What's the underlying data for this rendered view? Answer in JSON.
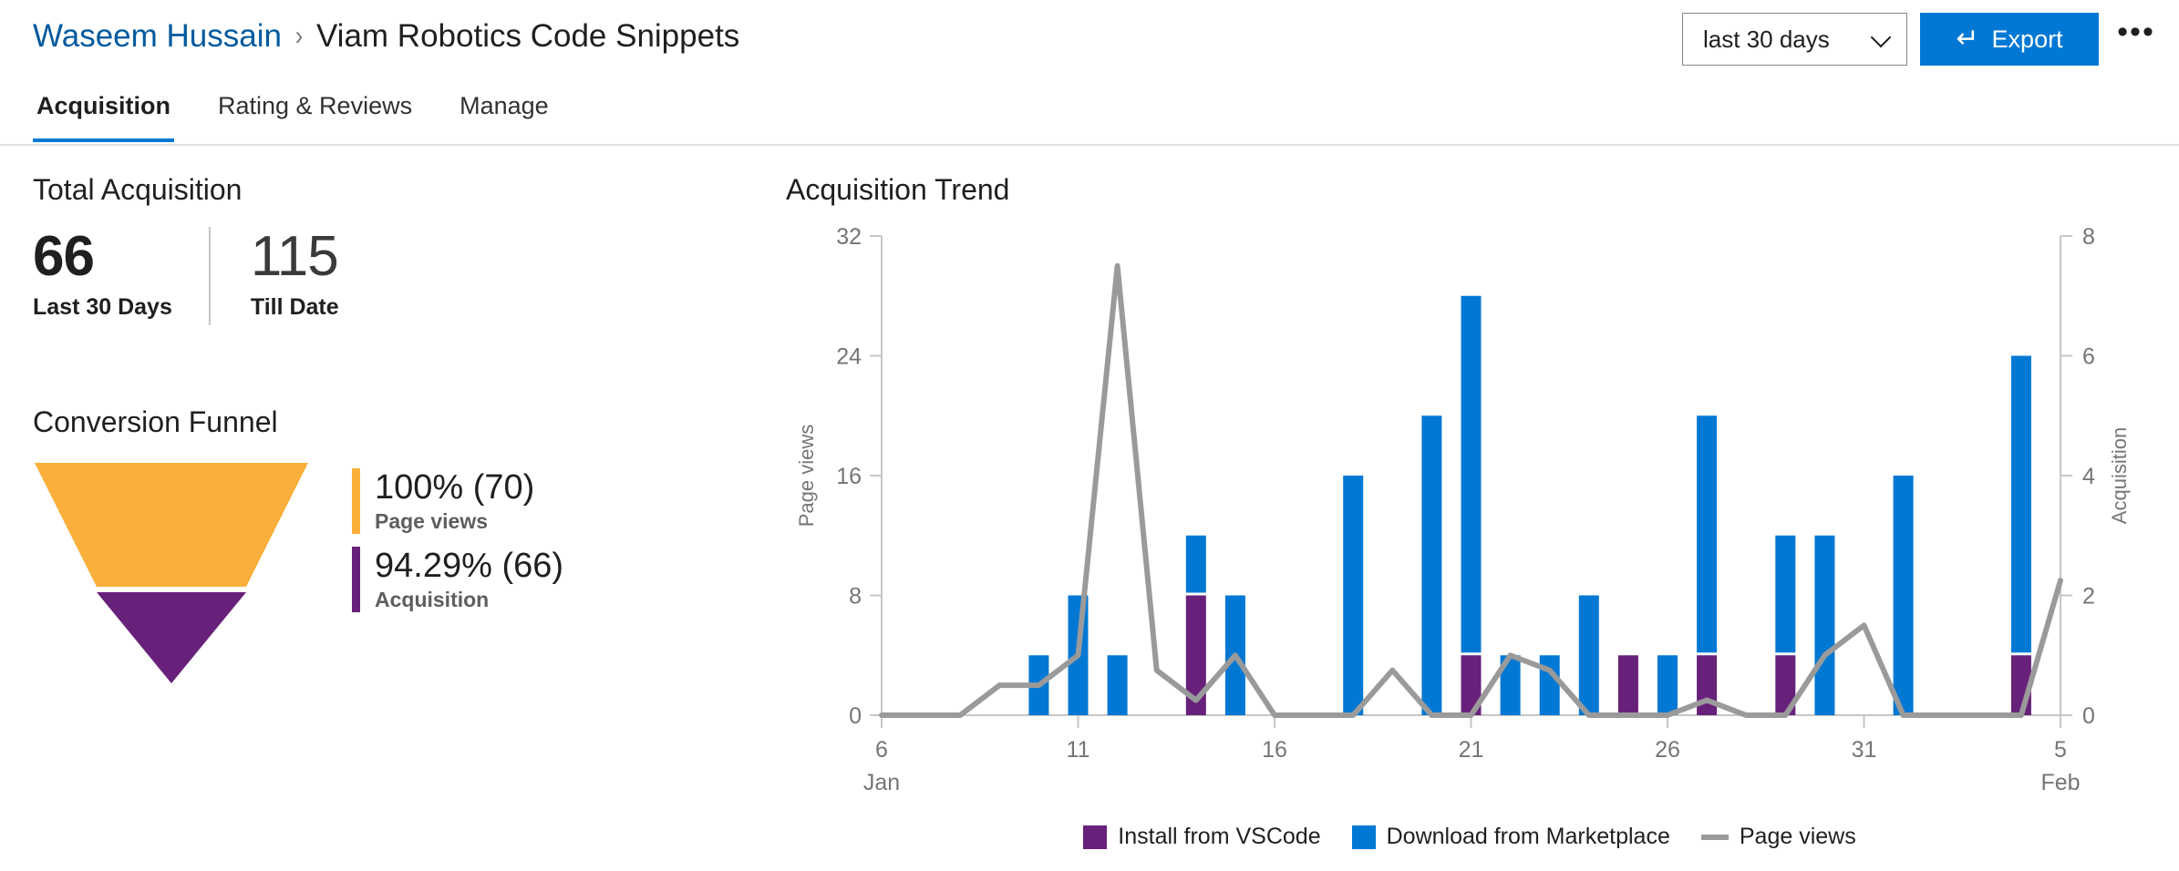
{
  "header": {
    "breadcrumb": {
      "parent": "Waseem Hussain",
      "separator": "›",
      "current": "Viam Robotics Code Snippets"
    },
    "date_range_value": "last 30 days",
    "export_label": "Export",
    "export_icon": "↵",
    "more_label": "•••"
  },
  "tabs": [
    {
      "label": "Acquisition",
      "active": true
    },
    {
      "label": "Rating & Reviews",
      "active": false
    },
    {
      "label": "Manage",
      "active": false
    }
  ],
  "total_acquisition": {
    "title": "Total Acquisition",
    "metrics": [
      {
        "value": "66",
        "label": "Last 30 Days"
      },
      {
        "value": "115",
        "label": "Till Date"
      }
    ]
  },
  "conversion_funnel": {
    "title": "Conversion Funnel",
    "stages": [
      {
        "value": "100% (70)",
        "name": "Page views",
        "color": "#FAAF3B"
      },
      {
        "value": "94.29% (66)",
        "name": "Acquisition",
        "color": "#68217A"
      }
    ]
  },
  "colors": {
    "install_vscode": "#68217A",
    "download_marketplace": "#0078D4",
    "page_views_line": "#9A9A9A",
    "funnel_top": "#FAAF3B",
    "funnel_bottom": "#68217A",
    "accent": "#0078D4",
    "link": "#005A9E",
    "axis": "#C8C6C4",
    "tick_text": "#757575"
  },
  "chart_data": {
    "type": "bar",
    "title": "Acquisition Trend",
    "xlabel": "",
    "ylabel": "Page views",
    "y2label": "Acquisition",
    "ylim": [
      0,
      32
    ],
    "y2lim": [
      0,
      8
    ],
    "yticks": [
      0,
      8,
      16,
      24,
      32
    ],
    "y2ticks": [
      0,
      2,
      4,
      6,
      8
    ],
    "grid": false,
    "legend_position": "bottom",
    "xtick_labels": [
      "6",
      "11",
      "16",
      "21",
      "26",
      "31",
      "5"
    ],
    "xtick_sublabels": [
      "Jan",
      "",
      "",
      "",
      "",
      "",
      "Feb"
    ],
    "x": [
      6,
      7,
      8,
      9,
      10,
      11,
      12,
      13,
      14,
      15,
      16,
      17,
      18,
      19,
      20,
      21,
      22,
      23,
      24,
      25,
      26,
      27,
      28,
      29,
      30,
      31,
      32,
      33,
      34,
      35,
      36
    ],
    "x_dates": [
      "Jan 6",
      "Jan 7",
      "Jan 8",
      "Jan 9",
      "Jan 10",
      "Jan 11",
      "Jan 12",
      "Jan 13",
      "Jan 14",
      "Jan 15",
      "Jan 16",
      "Jan 17",
      "Jan 18",
      "Jan 19",
      "Jan 20",
      "Jan 21",
      "Jan 22",
      "Jan 23",
      "Jan 24",
      "Jan 25",
      "Jan 26",
      "Jan 27",
      "Jan 28",
      "Jan 29",
      "Jan 30",
      "Jan 31",
      "Feb 1",
      "Feb 2",
      "Feb 3",
      "Feb 4",
      "Feb 5"
    ],
    "series": [
      {
        "name": "Install from VSCode",
        "type": "bar",
        "axis": "y2",
        "color": "#68217A",
        "values": [
          0,
          0,
          0,
          0,
          0,
          0,
          0,
          0,
          2,
          0,
          0,
          0,
          0,
          0,
          0,
          1,
          0,
          0,
          0,
          1,
          0,
          1,
          0,
          1,
          0,
          0,
          0,
          0,
          0,
          1,
          0
        ]
      },
      {
        "name": "Download from Marketplace",
        "type": "bar",
        "axis": "y2",
        "color": "#0078D4",
        "values": [
          0,
          0,
          0,
          0,
          1,
          2,
          1,
          0,
          1,
          2,
          0,
          0,
          4,
          0,
          5,
          6,
          1,
          1,
          2,
          0,
          1,
          4,
          0,
          2,
          3,
          0,
          4,
          0,
          0,
          5,
          0
        ]
      },
      {
        "name": "Page views",
        "type": "line",
        "axis": "y1",
        "color": "#9A9A9A",
        "values": [
          0,
          0,
          0,
          2,
          2,
          4,
          30,
          3,
          1,
          4,
          0,
          0,
          0,
          3,
          0,
          0,
          4,
          3,
          0,
          0,
          0,
          1,
          0,
          0,
          4,
          6,
          0,
          0,
          0,
          0,
          9,
          0
        ]
      }
    ]
  },
  "chart_legend": [
    {
      "label": "Install from VSCode",
      "marker": "square",
      "color": "#68217A"
    },
    {
      "label": "Download from Marketplace",
      "marker": "square",
      "color": "#0078D4"
    },
    {
      "label": "Page views",
      "marker": "line",
      "color": "#9A9A9A"
    }
  ]
}
